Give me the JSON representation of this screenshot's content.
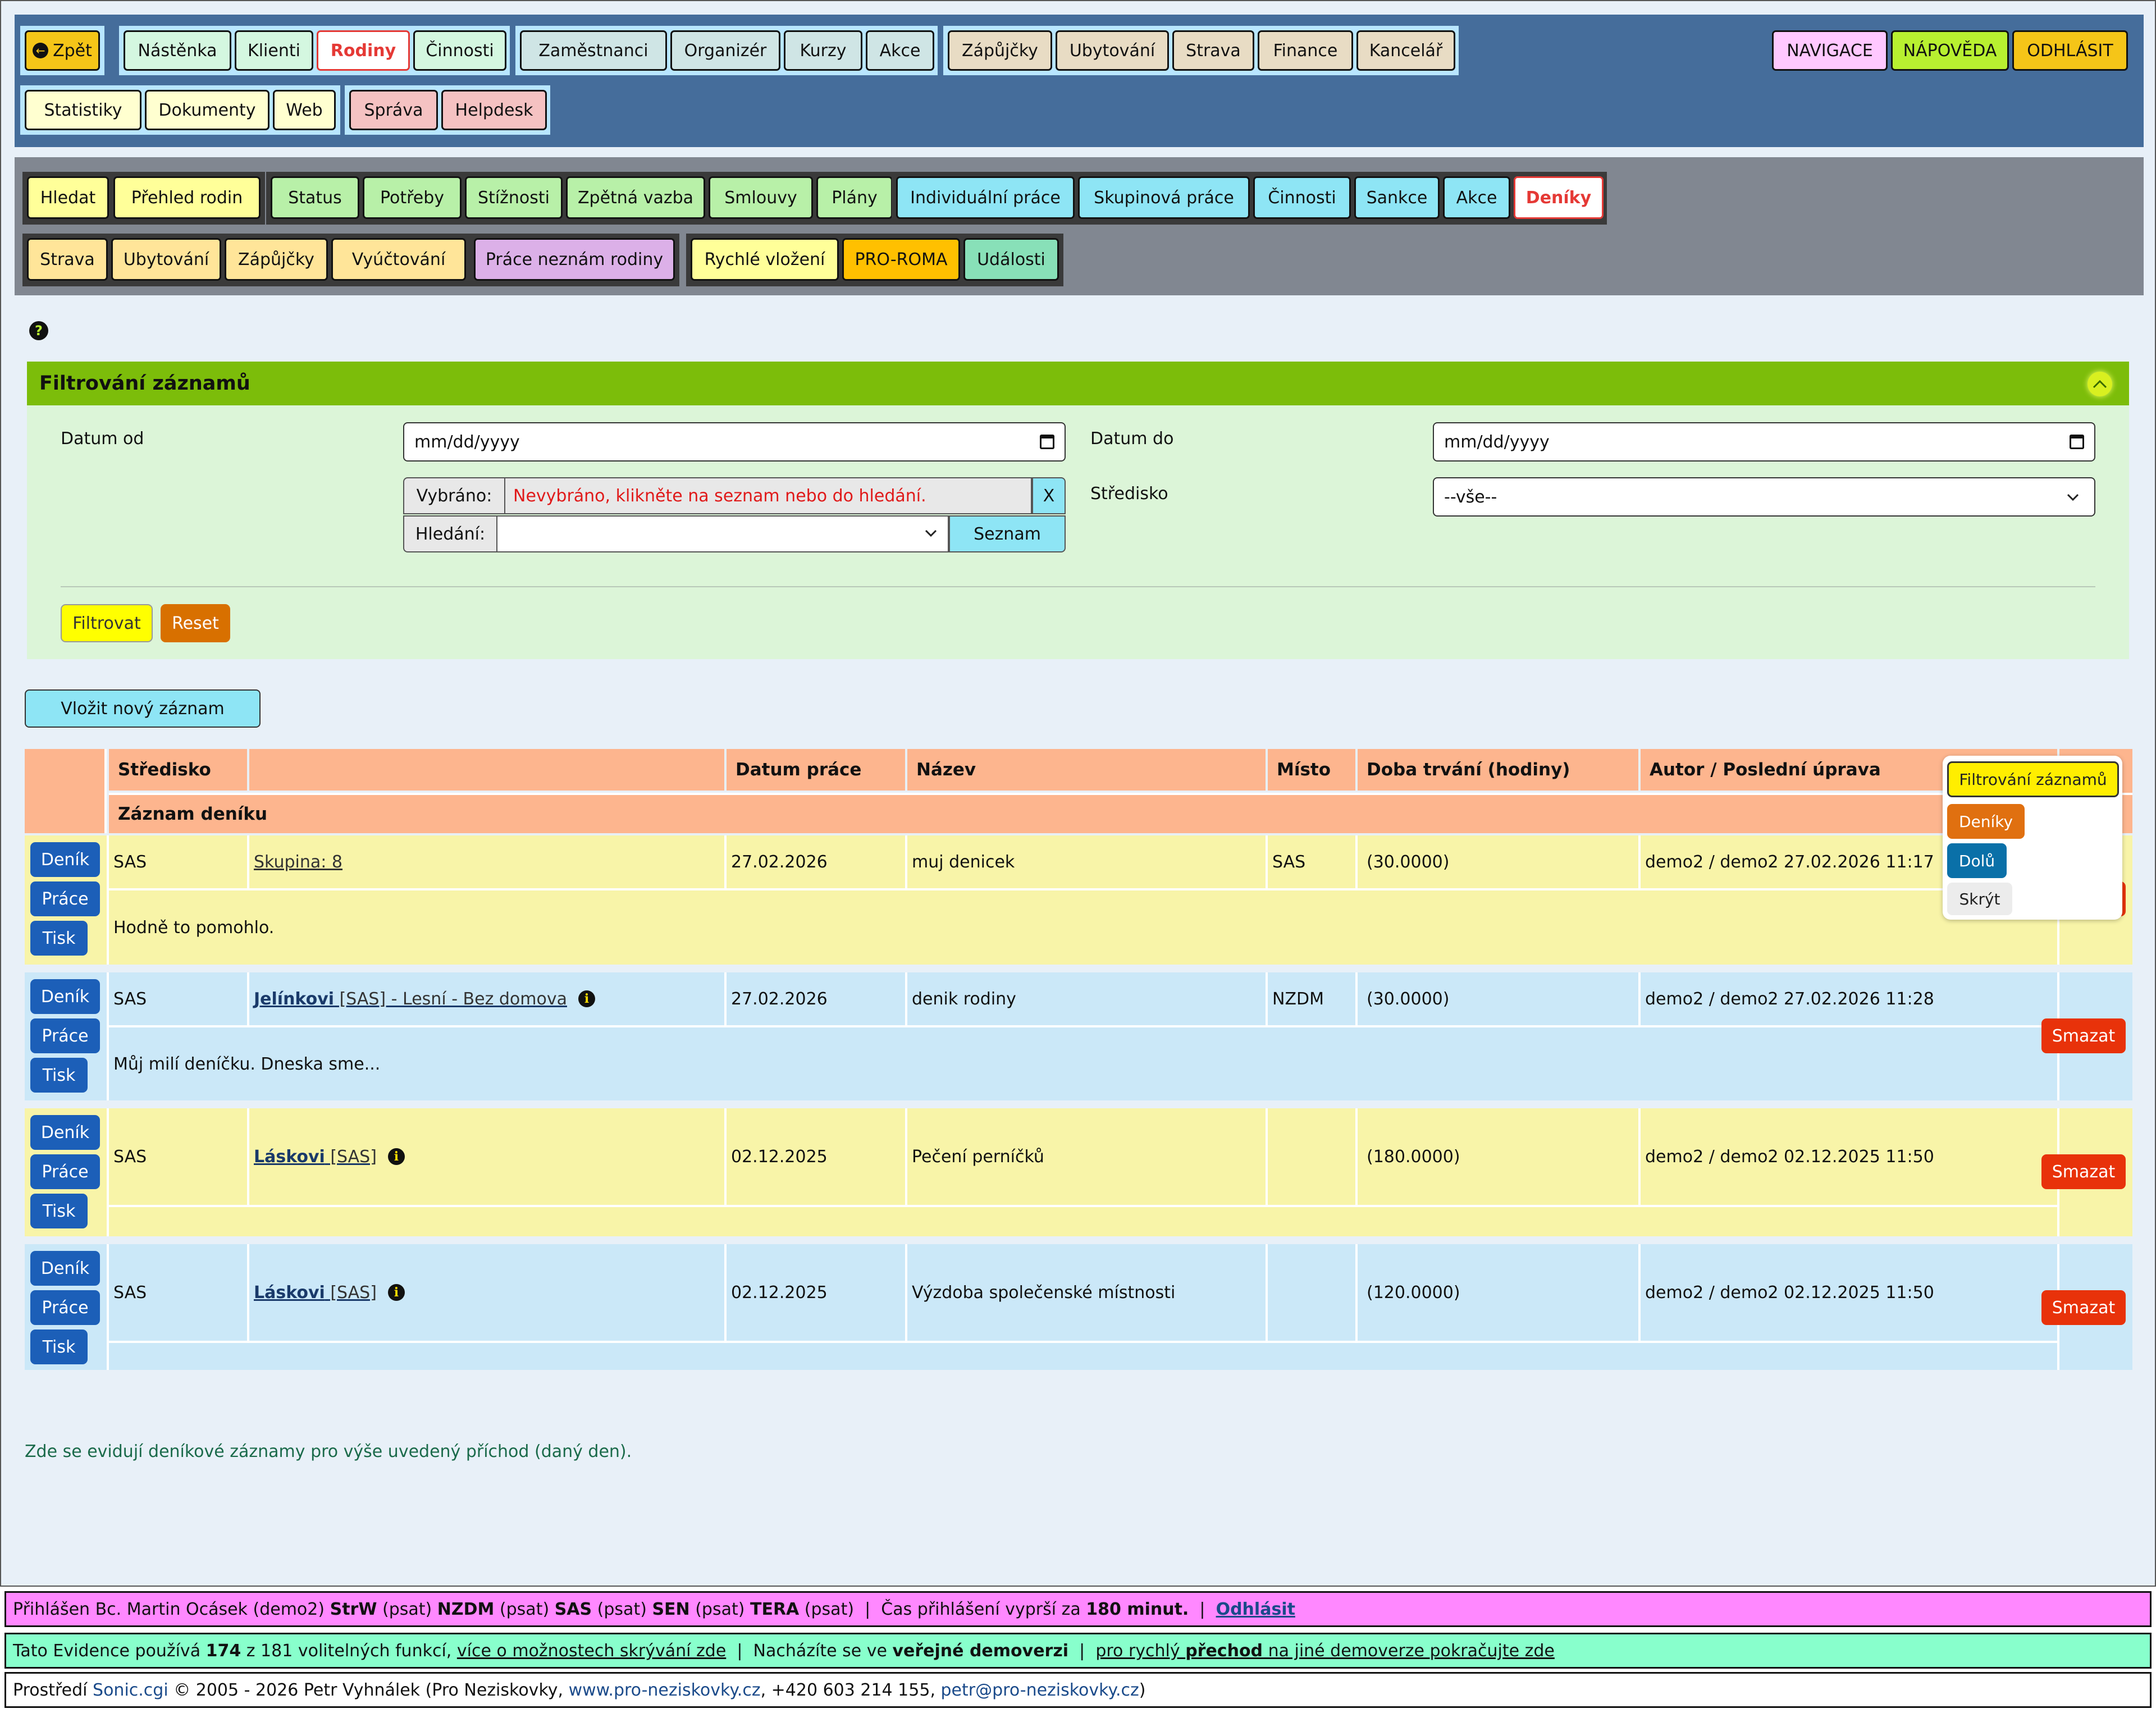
{
  "top_nav": {
    "back": "Zpět",
    "group1": [
      "Nástěnka",
      "Klienti",
      "Rodiny",
      "Činnosti"
    ],
    "group2": [
      "Zaměstnanci",
      "Organizér",
      "Kurzy",
      "Akce"
    ],
    "group3": [
      "Zápůjčky",
      "Ubytování",
      "Strava",
      "Finance",
      "Kancelář"
    ],
    "right": [
      "NAVIGACE",
      "NÁPOVĚDA",
      "ODHLÁSIT"
    ],
    "row2a": [
      "Statistiky",
      "Dokumenty",
      "Web"
    ],
    "row2b": [
      "Správa",
      "Helpdesk"
    ],
    "colors": {
      "bg": "#456d9b",
      "back": "#f5c518",
      "active": "#e53935"
    }
  },
  "sub_nav": {
    "g1": [
      "Hledat",
      "Přehled rodin"
    ],
    "g2": [
      "Status",
      "Potřeby",
      "Stížnosti",
      "Zpětná vazba",
      "Smlouvy",
      "Plány"
    ],
    "g3": [
      "Individuální práce",
      "Skupinová práce",
      "Činnosti",
      "Sankce",
      "Akce",
      "Deníky"
    ],
    "g4": [
      "Strava",
      "Ubytování",
      "Zápůjčky",
      "Vyúčtování"
    ],
    "g5": [
      "Práce neznám rodiny"
    ],
    "g6": [
      "Rychlé vložení",
      "PRO-ROMA",
      "Události"
    ]
  },
  "help_icon": "question-circle-icon",
  "filter": {
    "title": "Filtrování záznamů",
    "date_from_label": "Datum od",
    "date_from_placeholder": "mm/dd/yyyy",
    "date_to_label": "Datum do",
    "date_to_placeholder": "mm/dd/yyyy",
    "selected_label": "Vybráno:",
    "selected_value": "Nevybráno, klikněte na seznam nebo do hledání.",
    "clear": "X",
    "search_label": "Hledání:",
    "list_button": "Seznam",
    "center_label": "Středisko",
    "center_value": "--vše--",
    "filter_button": "Filtrovat",
    "reset_button": "Reset"
  },
  "new_record_button": "Vložit nový záznam",
  "table": {
    "headers": [
      "Středisko",
      "",
      "Datum práce",
      "Název",
      "Místo",
      "Doba trvání (hodiny)",
      "Autor / Poslední úprava"
    ],
    "subheader": "Záznam deníku",
    "action_labels": {
      "denik": "Deník",
      "prace": "Práce",
      "tisk": "Tisk",
      "smazat": "Smazat"
    },
    "rows": [
      {
        "stredisko": "SAS",
        "who_name": "Skupina: 8",
        "who_rest": "",
        "datum": "27.02.2026",
        "nazev": "muj denicek",
        "misto": "SAS",
        "doba": "(30.0000)",
        "autor": "demo2 / demo2 27.02.2026 11:17",
        "note": "Hodně to pomohlo."
      },
      {
        "stredisko": "SAS",
        "who_name": "Jelínkovi",
        "who_rest": " [SAS] - Lesní - Bez domova",
        "datum": "27.02.2026",
        "nazev": "denik rodiny",
        "misto": "NZDM",
        "doba": "(30.0000)",
        "autor": "demo2 / demo2 27.02.2026 11:28",
        "note": "Můj milí deníčku. Dneska sme..."
      },
      {
        "stredisko": "SAS",
        "who_name": "Láskovi",
        "who_rest": " [SAS]",
        "datum": "02.12.2025",
        "nazev": "Pečení perníčků",
        "misto": "",
        "doba": "(180.0000)",
        "autor": "demo2 / demo2 02.12.2025 11:50",
        "note": ""
      },
      {
        "stredisko": "SAS",
        "who_name": "Láskovi",
        "who_rest": " [SAS]",
        "datum": "02.12.2025",
        "nazev": "Výzdoba společenské místnosti",
        "misto": "",
        "doba": "(120.0000)",
        "autor": "demo2 / demo2 02.12.2025 11:50",
        "note": ""
      }
    ]
  },
  "floating_menu": [
    "Filtrování záznamů",
    "Deníky",
    "Dolů",
    "Skrýt"
  ],
  "bottom_note": "Zde se evidují deníkové záznamy pro výše uvedený příchod (daný den).",
  "footer1": {
    "t1": "Přihlášen Bc. Martin Ocásek (demo2) ",
    "b1": "StrW",
    "t2": " (psat) ",
    "b2": "NZDM",
    "t3": " (psat) ",
    "b3": "SAS",
    "t4": " (psat) ",
    "b4": "SEN",
    "t5": " (psat) ",
    "b5": "TERA",
    "t6": " (psat)  |  Čas přihlášení vyprší za ",
    "b6": "180 minut.",
    "t7": "  |  ",
    "logout": "Odhlásit"
  },
  "footer2": {
    "t1": "Tato Evidence používá ",
    "b1": "174",
    "t2": " z 181 volitelných funkcí, ",
    "u1": "více o možnostech skrývání zde",
    "t3": "  |  Nacházíte se ve ",
    "b2": "veřejné demoverzi",
    "t4": "  |  ",
    "u2a": "pro rychlý ",
    "u2b": "přechod",
    "u2c": " na jiné demoverze pokračujte zde"
  },
  "footer3": {
    "t1": "Prostředí ",
    "l1": "Sonic.cgi",
    "t2": " © 2005 - 2026 Petr Vyhnálek (Pro Neziskovky, ",
    "l2": "www.pro-neziskovky.cz",
    "t3": ", +420 603 214 155, ",
    "l3": "petr@pro-neziskovky.cz",
    "t4": ")"
  }
}
